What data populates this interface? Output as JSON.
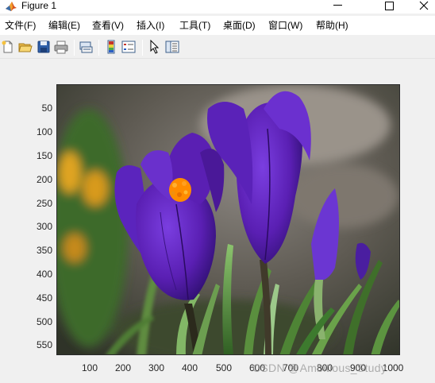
{
  "window": {
    "title": "Figure 1"
  },
  "menu": {
    "items": [
      {
        "label": "文件(F)"
      },
      {
        "label": "编辑(E)"
      },
      {
        "label": "查看(V)"
      },
      {
        "label": "插入(I)"
      },
      {
        "label": "工具(T)"
      },
      {
        "label": "桌面(D)"
      },
      {
        "label": "窗口(W)"
      },
      {
        "label": "帮助(H)"
      }
    ]
  },
  "toolbar": {
    "icons": [
      "new-figure-icon",
      "open-icon",
      "save-icon",
      "print-icon",
      "link-plot-icon",
      "colorbar-icon",
      "legend-icon",
      "pointer-icon",
      "property-inspector-icon"
    ]
  },
  "axes": {
    "y_ticks": [
      "50",
      "100",
      "150",
      "200",
      "250",
      "300",
      "350",
      "400",
      "450",
      "500",
      "550"
    ],
    "x_ticks": [
      "100",
      "200",
      "300",
      "400",
      "500",
      "600",
      "700",
      "800",
      "900",
      "1000"
    ]
  },
  "image": {
    "subject": "purple-crocus-photo"
  },
  "watermark": {
    "text": "CSDN @Ambitious_Study"
  },
  "colors": {
    "flower_purple": "#5a1fb3",
    "stamen_orange": "#ff8c00",
    "leaf_green": "#3d7a2e"
  }
}
